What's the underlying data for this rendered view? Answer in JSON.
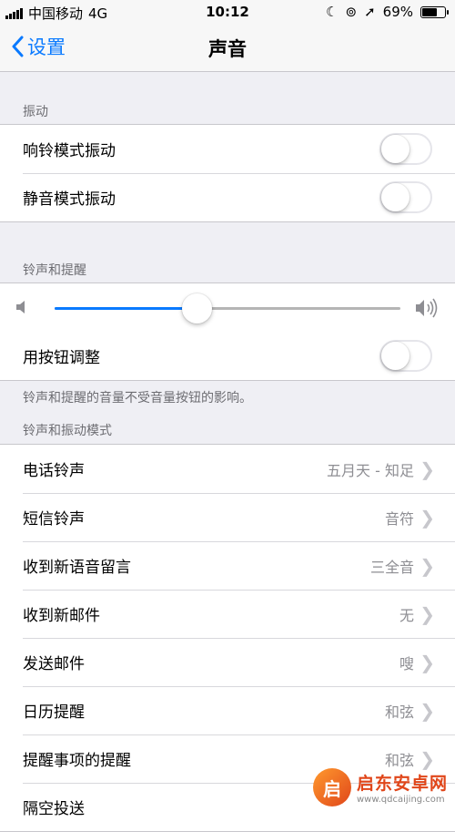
{
  "status": {
    "carrier": "中国移动",
    "network": "4G",
    "time": "10:12",
    "battery": "69%",
    "battery_level": 0.69
  },
  "nav": {
    "back_label": "设置",
    "title": "声音"
  },
  "vibration": {
    "header": "振动",
    "items": [
      {
        "label": "响铃模式振动",
        "on": false
      },
      {
        "label": "静音模式振动",
        "on": false
      }
    ]
  },
  "ringer": {
    "header": "铃声和提醒",
    "volume_level": 0.41,
    "adjust_label": "用按钮调整",
    "adjust_on": false,
    "footer": "铃声和提醒的音量不受音量按钮的影响。"
  },
  "patterns": {
    "header": "铃声和振动模式",
    "items": [
      {
        "label": "电话铃声",
        "value": "五月天 - 知足"
      },
      {
        "label": "短信铃声",
        "value": "音符"
      },
      {
        "label": "收到新语音留言",
        "value": "三全音"
      },
      {
        "label": "收到新邮件",
        "value": "无"
      },
      {
        "label": "发送邮件",
        "value": "嗖"
      },
      {
        "label": "日历提醒",
        "value": "和弦"
      },
      {
        "label": "提醒事项的提醒",
        "value": "和弦"
      },
      {
        "label": "隔空投送",
        "value": ""
      }
    ]
  },
  "watermark": {
    "logo_text": "启",
    "title": "启东安卓网",
    "url": "www.qdcaijing.com"
  },
  "colors": {
    "accent": "#0a7aff",
    "background": "#efeff4"
  }
}
